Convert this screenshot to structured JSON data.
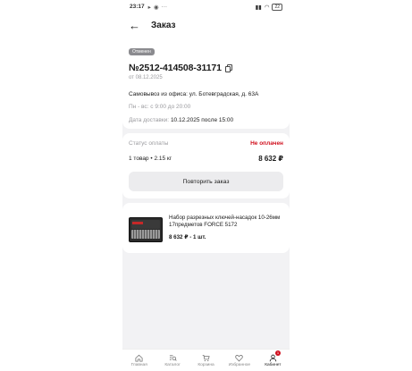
{
  "status_bar": {
    "time": "23:17",
    "battery": "22"
  },
  "header": {
    "title": "Заказ"
  },
  "order": {
    "status_badge": "Отменен",
    "number": "№2512-414508-31171",
    "date": "от 08.12.2025",
    "pickup": "Самовывоз из офиса: ул. Ботевградская, д. 63А",
    "hours": "Пн - вс: с 9:00 до 20:00",
    "delivery_label": "Дата доставки:",
    "delivery_value": "10.12.2025 после 15:00"
  },
  "payment": {
    "status_label": "Статус оплаты",
    "status_value": "Не оплачен",
    "items_summary": "1 товар • 2.15 кг",
    "total": "8 632 ₽",
    "repeat_button": "Повторить заказ",
    "status_color": "#d0101e"
  },
  "product": {
    "name": "Набор разрезных ключей-насадок 10-26мм 17предметов FORCE 5172",
    "price_qty": "8 632 ₽ - 1 шт."
  },
  "tabbar": {
    "items": [
      {
        "label": "Главная",
        "icon": "home-icon"
      },
      {
        "label": "Каталог",
        "icon": "catalog-search-icon"
      },
      {
        "label": "Корзина",
        "icon": "cart-icon"
      },
      {
        "label": "Избранное",
        "icon": "heart-icon"
      },
      {
        "label": "Кабинет",
        "icon": "user-icon",
        "badge": "1"
      }
    ],
    "active": "Кабинет"
  }
}
